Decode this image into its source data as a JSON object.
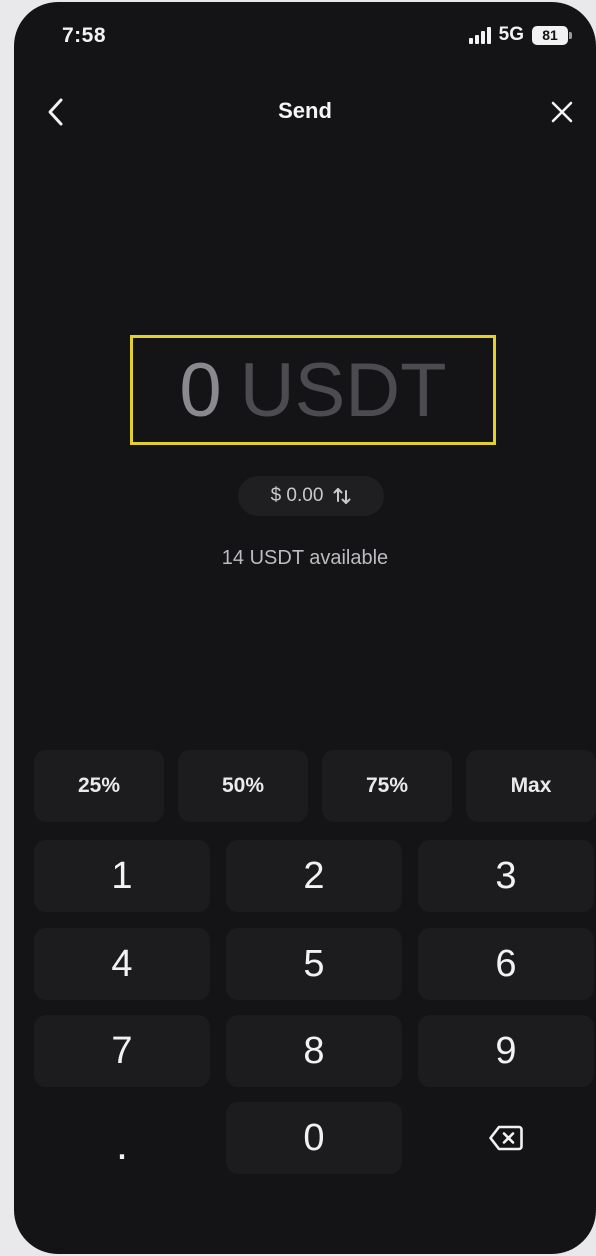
{
  "status_bar": {
    "time": "7:58",
    "network": "5G",
    "battery": "81"
  },
  "header": {
    "title": "Send",
    "back_icon": "chevron-left-icon",
    "close_icon": "close-icon"
  },
  "amount": {
    "value": "0",
    "unit": "USDT",
    "highlight_color": "#e2d12a"
  },
  "fiat": {
    "text": "$ 0.00",
    "swap_icon": "swap-arrows-icon"
  },
  "balance": {
    "text": "14 USDT available"
  },
  "percent_buttons": [
    "25%",
    "50%",
    "75%",
    "Max"
  ],
  "keypad": {
    "keys": [
      "1",
      "2",
      "3",
      "4",
      "5",
      "6",
      "7",
      "8",
      "9",
      ".",
      "0"
    ],
    "backspace_icon": "backspace-icon"
  }
}
